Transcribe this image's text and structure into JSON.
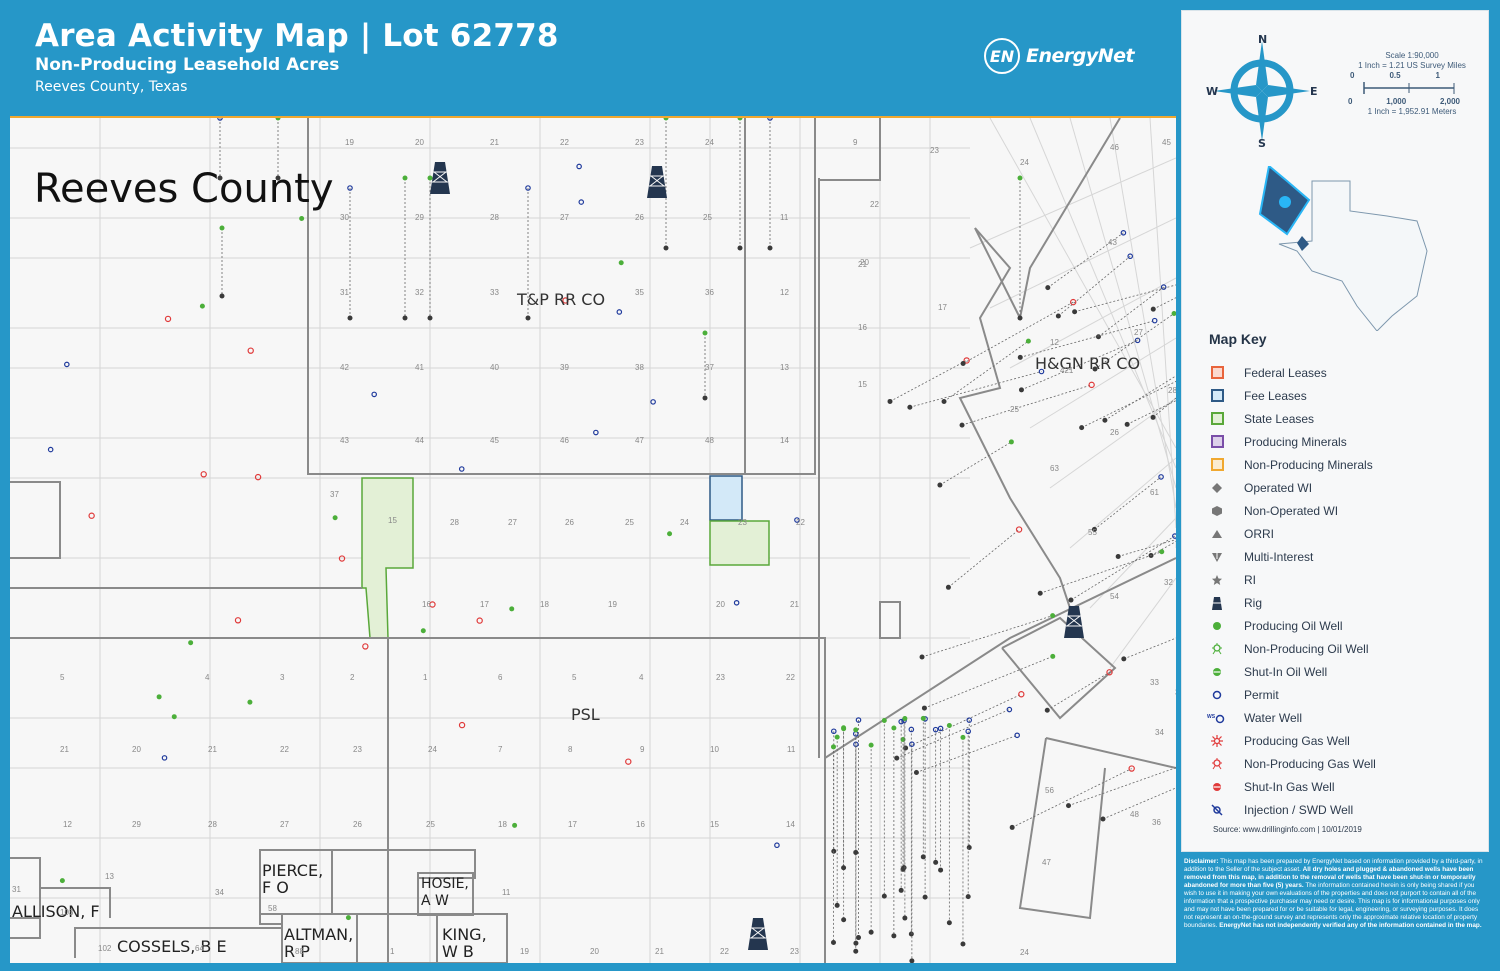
{
  "header": {
    "title": "Area Activity Map | Lot 62778",
    "subtitle": "Non-Producing Leasehold Acres",
    "location": "Reeves County, Texas",
    "logo_mark": "EN",
    "logo_text": "EnergyNet"
  },
  "map": {
    "county_label": "Reeves County",
    "survey_labels": [
      "T&P RR CO",
      "H&GN RR CO",
      "PSL"
    ],
    "owner_labels": [
      {
        "id": "pierce",
        "text": "PIERCE, F O"
      },
      {
        "id": "hosie",
        "text": "HOSIE, A W"
      },
      {
        "id": "allison",
        "text": "ALLISON, F"
      },
      {
        "id": "cossels",
        "text": "COSSELS, B E"
      },
      {
        "id": "altman",
        "text": "ALTMAN, R P"
      },
      {
        "id": "king",
        "text": "KING, W B"
      }
    ],
    "section_numbers": [
      "19",
      "20",
      "21",
      "22",
      "23",
      "24",
      "9",
      "23",
      "24",
      "30",
      "29",
      "28",
      "27",
      "26",
      "25",
      "11",
      "22",
      "20",
      "21",
      "31",
      "32",
      "33",
      "35",
      "36",
      "12",
      "16",
      "17",
      "42",
      "41",
      "40",
      "39",
      "38",
      "37",
      "13",
      "43",
      "44",
      "45",
      "46",
      "47",
      "48",
      "14",
      "15",
      "37",
      "15",
      "28",
      "27",
      "26",
      "25",
      "24",
      "23",
      "22",
      "16",
      "17",
      "18",
      "19",
      "20",
      "21",
      "5",
      "4",
      "3",
      "2",
      "1",
      "6",
      "5",
      "4",
      "23",
      "22",
      "21",
      "20",
      "21",
      "22",
      "23",
      "24",
      "7",
      "8",
      "9",
      "10",
      "11",
      "12",
      "29",
      "28",
      "27",
      "26",
      "25",
      "18",
      "17",
      "16",
      "15",
      "14",
      "13",
      "34",
      "31",
      "103",
      "102",
      "64",
      "58",
      "88",
      "1",
      "11",
      "19",
      "20",
      "21",
      "22",
      "23",
      "24",
      "25",
      "26",
      "27",
      "28",
      "63",
      "55",
      "61",
      "54",
      "56",
      "47",
      "48",
      "45",
      "46",
      "43",
      "12",
      "421",
      "32",
      "33",
      "34",
      "35",
      "36",
      "40",
      "41",
      "44",
      "1",
      "11",
      "12",
      "13",
      "14"
    ],
    "lease_highlights": [
      {
        "type": "State Leases",
        "section": "15"
      },
      {
        "type": "Fee Leases",
        "section": "23"
      },
      {
        "type": "State Leases",
        "section": "23"
      }
    ]
  },
  "sidebar": {
    "compass": {
      "n": "N",
      "s": "S",
      "e": "E",
      "w": "W"
    },
    "scale": {
      "ratio": "Scale 1:90,000",
      "miles_note": "1 Inch = 1.21 US Survey Miles",
      "mile_ticks": [
        "0",
        "0.5",
        "1"
      ],
      "meter_ticks": [
        "0",
        "1,000",
        "2,000"
      ],
      "meters_note": "1 Inch = 1,952.91 Meters"
    },
    "key_title": "Map Key",
    "key_items": [
      {
        "label": "Federal Leases",
        "icon": "box",
        "stroke": "#e8643c",
        "fill": "#fbd9cf"
      },
      {
        "label": "Fee Leases",
        "icon": "box",
        "stroke": "#2e5a86",
        "fill": "#d3e9f8"
      },
      {
        "label": "State Leases",
        "icon": "box",
        "stroke": "#5aa83a",
        "fill": "#e3f0d6"
      },
      {
        "label": "Producing Minerals",
        "icon": "box",
        "stroke": "#7a4ea8",
        "fill": "#ddd0ea"
      },
      {
        "label": "Non-Producing Minerals",
        "icon": "box",
        "stroke": "#f0a830",
        "fill": "#fbecd0"
      },
      {
        "label": "Operated WI",
        "icon": "diamond",
        "color": "#777777"
      },
      {
        "label": "Non-Operated WI",
        "icon": "hexagon",
        "color": "#777777"
      },
      {
        "label": "ORRI",
        "icon": "triangle",
        "color": "#777777"
      },
      {
        "label": "Multi-Interest",
        "icon": "multi",
        "color": "#777777"
      },
      {
        "label": "RI",
        "icon": "star",
        "color": "#777777"
      },
      {
        "label": "Rig",
        "icon": "rig",
        "color": "#24364f"
      },
      {
        "label": "Producing Oil Well",
        "icon": "dot",
        "color": "#4caf3a"
      },
      {
        "label": "Non-Producing Oil Well",
        "icon": "np-well",
        "color": "#4caf3a"
      },
      {
        "label": "Shut-In Oil Well",
        "icon": "shut-in",
        "color": "#4caf3a"
      },
      {
        "label": "Permit",
        "icon": "circle",
        "color": "#1f3a9c"
      },
      {
        "label": "Water Well",
        "icon": "water",
        "color": "#1f3a9c"
      },
      {
        "label": "Producing Gas Well",
        "icon": "gas",
        "color": "#e03a3a"
      },
      {
        "label": "Non-Producing Gas Well",
        "icon": "np-well",
        "color": "#e03a3a"
      },
      {
        "label": "Shut-In Gas Well",
        "icon": "shut-in",
        "color": "#e03a3a"
      },
      {
        "label": "Injection / SWD Well",
        "icon": "injection",
        "color": "#1f3a9c"
      }
    ],
    "source": "Source: www.drillinginfo.com | 10/01/2019"
  },
  "disclaimer": {
    "lead": "Disclaimer:",
    "part1": " This map has been prepared by EnergyNet based on information provided by a third-party, in addition to the Seller of the subject asset. ",
    "bold1": "All dry holes and plugged & abandoned wells have been removed from this map, in addition to the removal of wells that have been shut-in or temporarily abandoned for more than five (5) years.",
    "part2": " The information contained herein is only being shared if you wish to use it in making your own evaluations of the properties and does not purport to contain all of the information that a prospective purchaser may need or desire. This map is for informational purposes only and may not have been prepared for or be suitable for legal, engineering, or surveying purposes. It does not represent an on-the-ground survey and represents only the approximate relative location of property boundaries. ",
    "bold2": "EnergyNet has not independently verified any of the information contained in the map."
  },
  "colors": {
    "brand_blue": "#2697c8",
    "map_bg": "#f7f7f7",
    "boundary": "#888888",
    "grid": "#d4d4d4",
    "state_lease": "#e3f0d6",
    "fee_lease": "#d3e9f8",
    "rig": "#24364f"
  }
}
